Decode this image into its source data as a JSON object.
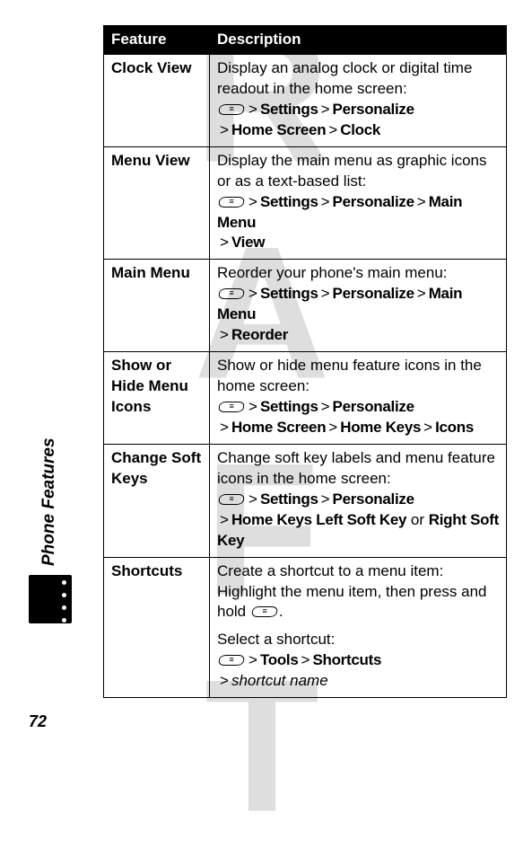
{
  "watermark": "DRAFT",
  "side_label": "Phone Features",
  "page_number": "72",
  "table": {
    "header_feature": "Feature",
    "header_description": "Description",
    "rows": [
      {
        "feature": "Clock View",
        "intro": "Display an analog clock or digital time readout in the home screen:",
        "path": [
          {
            "type": "key",
            "value": "menu"
          },
          {
            "type": "sep",
            "value": ">"
          },
          {
            "type": "menu",
            "value": "Settings"
          },
          {
            "type": "sep",
            "value": ">"
          },
          {
            "type": "menu",
            "value": "Personalize"
          },
          {
            "type": "break"
          },
          {
            "type": "sep",
            "value": ">"
          },
          {
            "type": "menu",
            "value": "Home Screen"
          },
          {
            "type": "sep",
            "value": ">"
          },
          {
            "type": "menu",
            "value": "Clock"
          }
        ]
      },
      {
        "feature": "Menu View",
        "intro": "Display the main menu as graphic icons or as a text-based list:",
        "path": [
          {
            "type": "key",
            "value": "menu"
          },
          {
            "type": "sep",
            "value": ">"
          },
          {
            "type": "menu",
            "value": "Settings"
          },
          {
            "type": "sep",
            "value": ">"
          },
          {
            "type": "menu",
            "value": "Personalize"
          },
          {
            "type": "sep",
            "value": ">"
          },
          {
            "type": "menu",
            "value": "Main Menu"
          },
          {
            "type": "break"
          },
          {
            "type": "sep",
            "value": ">"
          },
          {
            "type": "menu",
            "value": "View"
          }
        ]
      },
      {
        "feature": "Main Menu",
        "intro": "Reorder your phone's main menu:",
        "path": [
          {
            "type": "key",
            "value": "menu"
          },
          {
            "type": "sep",
            "value": ">"
          },
          {
            "type": "menu",
            "value": "Settings"
          },
          {
            "type": "sep",
            "value": ">"
          },
          {
            "type": "menu",
            "value": "Personalize"
          },
          {
            "type": "sep",
            "value": ">"
          },
          {
            "type": "menu",
            "value": "Main Menu"
          },
          {
            "type": "break"
          },
          {
            "type": "sep",
            "value": ">"
          },
          {
            "type": "menu",
            "value": "Reorder"
          }
        ]
      },
      {
        "feature": "Show or Hide Menu Icons",
        "intro": "Show or hide menu feature icons in the home screen:",
        "path": [
          {
            "type": "key",
            "value": "menu"
          },
          {
            "type": "sep",
            "value": ">"
          },
          {
            "type": "menu",
            "value": "Settings"
          },
          {
            "type": "sep",
            "value": ">"
          },
          {
            "type": "menu",
            "value": "Personalize"
          },
          {
            "type": "break"
          },
          {
            "type": "sep",
            "value": ">"
          },
          {
            "type": "menu",
            "value": "Home Screen"
          },
          {
            "type": "sep",
            "value": ">"
          },
          {
            "type": "menu",
            "value": "Home Keys"
          },
          {
            "type": "sep",
            "value": ">"
          },
          {
            "type": "menu",
            "value": "Icons"
          }
        ]
      },
      {
        "feature": "Change Soft Keys",
        "intro": "Change soft key labels and menu feature icons in the home screen:",
        "path": [
          {
            "type": "key",
            "value": "menu"
          },
          {
            "type": "sep",
            "value": ">"
          },
          {
            "type": "menu",
            "value": "Settings"
          },
          {
            "type": "sep",
            "value": ">"
          },
          {
            "type": "menu",
            "value": "Personalize"
          },
          {
            "type": "break"
          },
          {
            "type": "sep",
            "value": ">"
          },
          {
            "type": "menu",
            "value": "Home Keys Left Soft Key"
          },
          {
            "type": "text",
            "value": " or "
          },
          {
            "type": "menu",
            "value": "Right Soft Key"
          }
        ]
      },
      {
        "feature": "Shortcuts",
        "intro": "Create a shortcut to a menu item: Highlight the menu item, then press and hold ",
        "intro_has_key_suffix": true,
        "intro_suffix": ".",
        "extra_intro": "Select a shortcut:",
        "path": [
          {
            "type": "key",
            "value": "menu"
          },
          {
            "type": "sep",
            "value": ">"
          },
          {
            "type": "menu",
            "value": "Tools"
          },
          {
            "type": "sep",
            "value": ">"
          },
          {
            "type": "menu",
            "value": "Shortcuts"
          },
          {
            "type": "break"
          },
          {
            "type": "sep",
            "value": ">"
          },
          {
            "type": "italic",
            "value": "shortcut name"
          }
        ]
      }
    ]
  }
}
